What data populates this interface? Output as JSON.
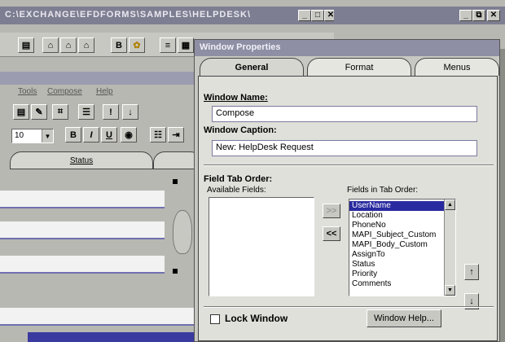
{
  "back_window": {
    "title": "C:\\EXCHANGE\\EFDFORMS\\SAMPLES\\HELPDESK\\",
    "menu_items": [
      "Tools",
      "Compose",
      "Help"
    ],
    "font_size": "10",
    "column_header": "Status"
  },
  "right_window": {
    "title": ""
  },
  "props": {
    "title": "Window Properties",
    "tabs": [
      "General",
      "Format",
      "Menus"
    ],
    "window_name_label": "Window Name:",
    "window_name_value": "Compose",
    "caption_label": "Window Caption:",
    "caption_value": "New: HelpDesk Request",
    "tab_order_label": "Field Tab Order:",
    "available_label": "Available Fields:",
    "in_order_label": "Fields in Tab Order:",
    "add_button": ">>",
    "remove_button": "<<",
    "fields": [
      "UserName",
      "Location",
      "PhoneNo",
      "MAPI_Subject_Custom",
      "MAPI_Body_Custom",
      "AssignTo",
      "Status",
      "Priority",
      "Comments"
    ],
    "lock_label": "Lock Window",
    "help_button": "Window Help..."
  },
  "colors": {
    "title_active": "#6a6aa8",
    "desk": "#8a8c86",
    "selected": "#2a2aa0"
  }
}
